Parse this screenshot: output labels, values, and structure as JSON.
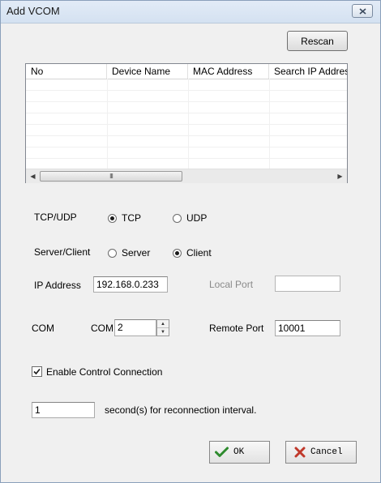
{
  "window": {
    "title": "Add VCOM"
  },
  "toolbar": {
    "rescan_label": "Rescan"
  },
  "device_list": {
    "columns": [
      "No",
      "Device Name",
      "MAC Address",
      "Search IP Address"
    ],
    "scrollbar_grip": "III"
  },
  "protocol": {
    "label": "TCP/UDP",
    "options": [
      "TCP",
      "UDP"
    ],
    "selected": "TCP"
  },
  "mode": {
    "label": "Server/Client",
    "options": [
      "Server",
      "Client"
    ],
    "selected": "Client"
  },
  "ip_address": {
    "label": "IP Address",
    "value": "192.168.0.233"
  },
  "local_port": {
    "label": "Local Port",
    "value": ""
  },
  "com": {
    "label": "COM",
    "sub_label": "COM",
    "value": "2"
  },
  "remote_port": {
    "label": "Remote Port",
    "value": "10001"
  },
  "control_connection": {
    "label": "Enable Control Connection",
    "checked": true
  },
  "reconnection": {
    "value": "1",
    "suffix": "second(s) for reconnection interval."
  },
  "footer": {
    "ok_label": "OK",
    "cancel_label": "Cancel"
  },
  "colors": {
    "ok_check": "#2e8b2e",
    "cancel_x": "#c0392b",
    "title_bar": "#d4e1f1"
  }
}
